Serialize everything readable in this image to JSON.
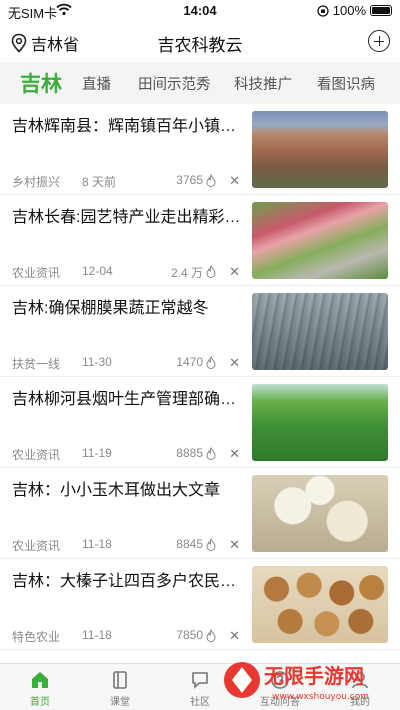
{
  "status_bar": {
    "carrier": "无SIM卡",
    "time": "14:04",
    "battery": "100%"
  },
  "header": {
    "location": "吉林省",
    "title": "吉农科教云"
  },
  "tabs": [
    "吉林",
    "直播",
    "田间示范秀",
    "科技推广",
    "看图识病"
  ],
  "news": [
    {
      "title": "吉林辉南县：辉南镇百年小镇焕发新活力",
      "source": "乡村振兴",
      "date": "8 天前",
      "views": "3765"
    },
    {
      "title": "吉林长春:园艺特产业走出精彩之路",
      "source": "农业资讯",
      "date": "12-04",
      "views": "2.4 万"
    },
    {
      "title": "吉林:确保棚膜果蔬正常越冬",
      "source": "扶贫一线",
      "date": "11-30",
      "views": "1470"
    },
    {
      "title": "吉林柳河县烟叶生产管理部确保丰收",
      "source": "农业资讯",
      "date": "11-19",
      "views": "8885"
    },
    {
      "title": "吉林：小小玉木耳做出大文章",
      "source": "农业资讯",
      "date": "11-18",
      "views": "8845"
    },
    {
      "title": "吉林：大榛子让四百多户农民增收",
      "source": "特色农业",
      "date": "11-18",
      "views": "7850"
    }
  ],
  "bottom_tabs": [
    "首页",
    "课堂",
    "社区",
    "互动问答",
    "我的"
  ],
  "watermark": {
    "brand": "无限手游网",
    "url": "www.wxshouyou.com"
  },
  "colors": {
    "accent": "#3aae3a",
    "meta": "#8a8a8a",
    "tab_bg": "#f4f4f4"
  },
  "icons": {
    "location": "location-pin-icon",
    "add": "plus-circle-icon",
    "wifi": "wifi-icon",
    "battery": "battery-icon",
    "hot": "flame-icon",
    "dismiss": "close-icon",
    "home": "home-icon",
    "class": "book-icon",
    "community": "chat-icon",
    "qa": "question-icon",
    "me": "person-icon"
  }
}
